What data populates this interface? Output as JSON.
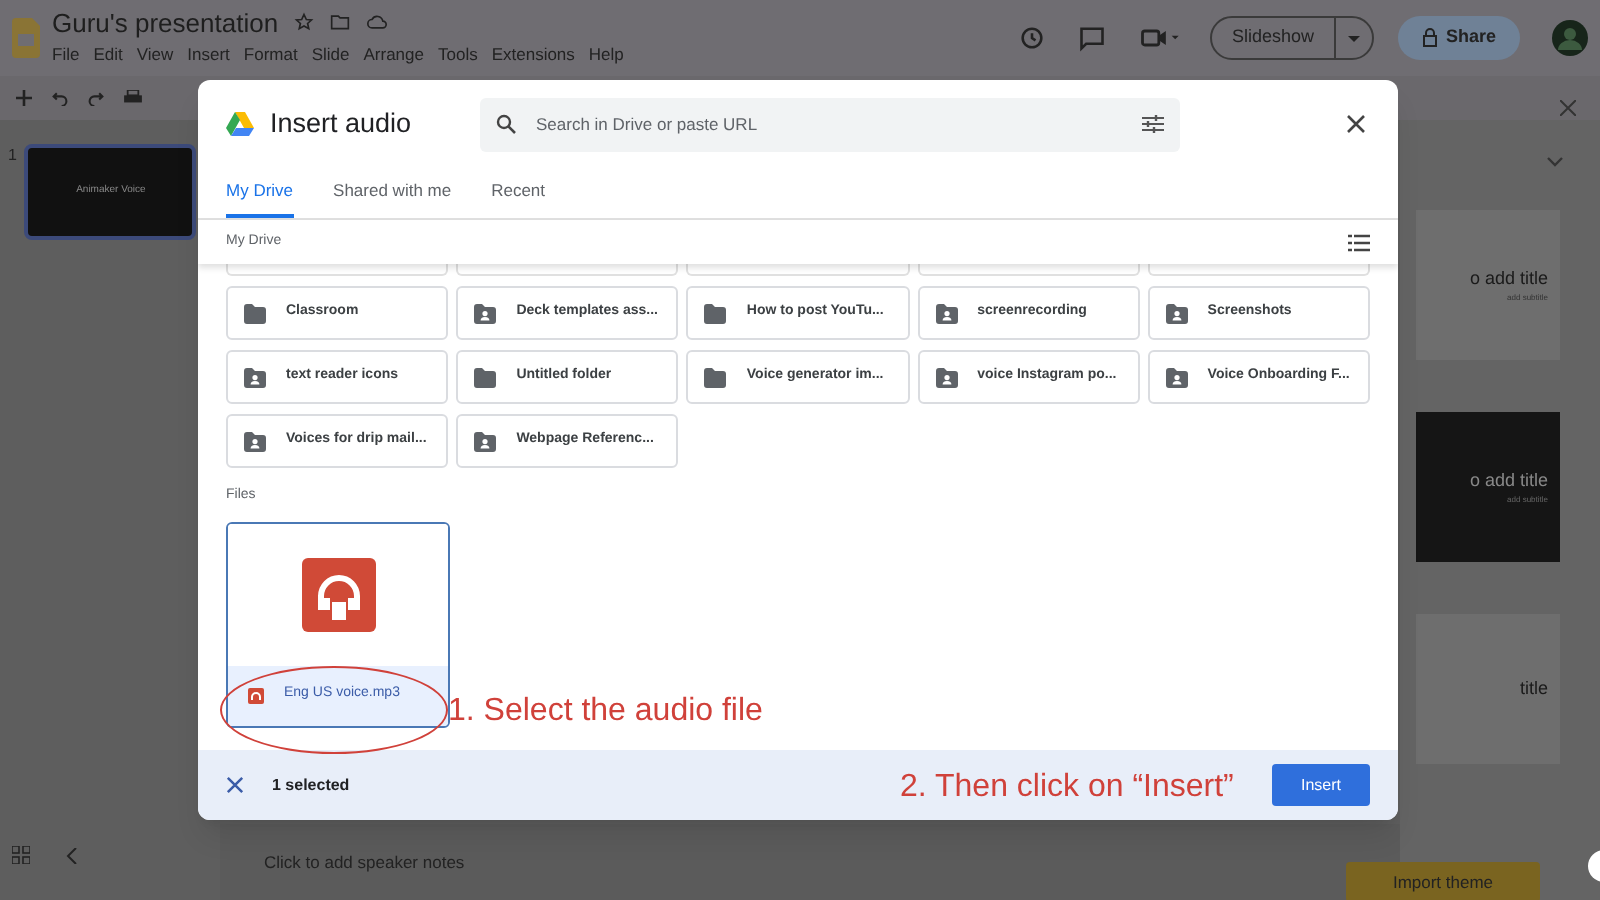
{
  "app": {
    "title": "Guru's presentation",
    "menu": [
      "File",
      "Edit",
      "View",
      "Insert",
      "Format",
      "Slide",
      "Arrange",
      "Tools",
      "Extensions",
      "Help"
    ],
    "slideshow": "Slideshow",
    "share": "Share"
  },
  "filmstrip": [
    {
      "number": "1",
      "title": "Animaker Voice",
      "selected": true
    }
  ],
  "themes": [
    {
      "kind": "light",
      "title": "o add title",
      "subtitle": "add subtitle"
    },
    {
      "kind": "dark",
      "title": "o add title",
      "subtitle": "add subtitle"
    },
    {
      "kind": "light",
      "title": "title"
    }
  ],
  "speaker_notes": "Click to add speaker notes",
  "import_theme": "Import theme",
  "dialog": {
    "title": "Insert audio",
    "search": {
      "placeholder": "Search in Drive or paste URL"
    },
    "tabs": [
      {
        "label": "My Drive",
        "selected": true
      },
      {
        "label": "Shared with me",
        "selected": false
      },
      {
        "label": "Recent",
        "selected": false
      }
    ],
    "breadcrumb": "My Drive",
    "folders": [
      {
        "name": "Classroom",
        "shared": false
      },
      {
        "name": "Deck templates ass...",
        "shared": true
      },
      {
        "name": "How to post YouTu...",
        "shared": false
      },
      {
        "name": "screenrecording",
        "shared": true
      },
      {
        "name": "Screenshots",
        "shared": true
      },
      {
        "name": "text reader icons",
        "shared": true
      },
      {
        "name": "Untitled folder",
        "shared": false
      },
      {
        "name": "Voice generator im...",
        "shared": false
      },
      {
        "name": "voice Instagram po...",
        "shared": true
      },
      {
        "name": "Voice Onboarding F...",
        "shared": true
      },
      {
        "name": "Voices for drip mail...",
        "shared": true
      },
      {
        "name": "Webpage Referenc...",
        "shared": true
      }
    ],
    "files_label": "Files",
    "files": [
      {
        "name": "Eng US voice.mp3",
        "selected": true
      }
    ],
    "selection_count": "1 selected",
    "insert": "Insert"
  },
  "annotations": [
    {
      "text": "1. Select the audio file"
    },
    {
      "text": "2. Then click on “Insert”"
    }
  ]
}
